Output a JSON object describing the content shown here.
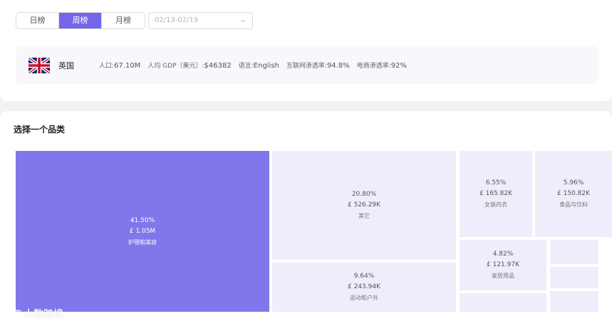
{
  "tabs": [
    {
      "label": "日榜"
    },
    {
      "label": "周榜"
    },
    {
      "label": "月榜"
    }
  ],
  "active_tab": "周榜",
  "date_range": {
    "placeholder": "02/13-02/19"
  },
  "country": {
    "name": "英国",
    "flag_icon": "uk-flag-icon",
    "stats": [
      {
        "label": "人口:",
        "value": "67.10M"
      },
      {
        "label": "人均 GDP（美元）:",
        "value": "$46382"
      },
      {
        "label": "语言:",
        "value": "English"
      },
      {
        "label": "互联网渗透率:",
        "value": "94.8%"
      },
      {
        "label": "电商渗透率:",
        "value": "92%"
      }
    ]
  },
  "section_title": "选择一个品类",
  "categories": [
    {
      "pct": "41.50%",
      "value": "£ 1.05M",
      "name": "护理和美容"
    },
    {
      "pct": "20.80%",
      "value": "£ 526.29K",
      "name": "其它"
    },
    {
      "pct": "9.64%",
      "value": "£ 243.94K",
      "name": "运动和户外"
    },
    {
      "pct": "6.55%",
      "value": "£ 165.82K",
      "name": "女装内衣"
    },
    {
      "pct": "5.96%",
      "value": "£ 150.82K",
      "name": "食品与饮料"
    },
    {
      "pct": "4.82%",
      "value": "£ 121.97K",
      "name": "家居用品"
    }
  ],
  "colors": {
    "accent": "#7466e8",
    "treemap_primary": "#8177ec",
    "treemap_cell": "#eeedfb"
  },
  "watermark": "大数跨境"
}
